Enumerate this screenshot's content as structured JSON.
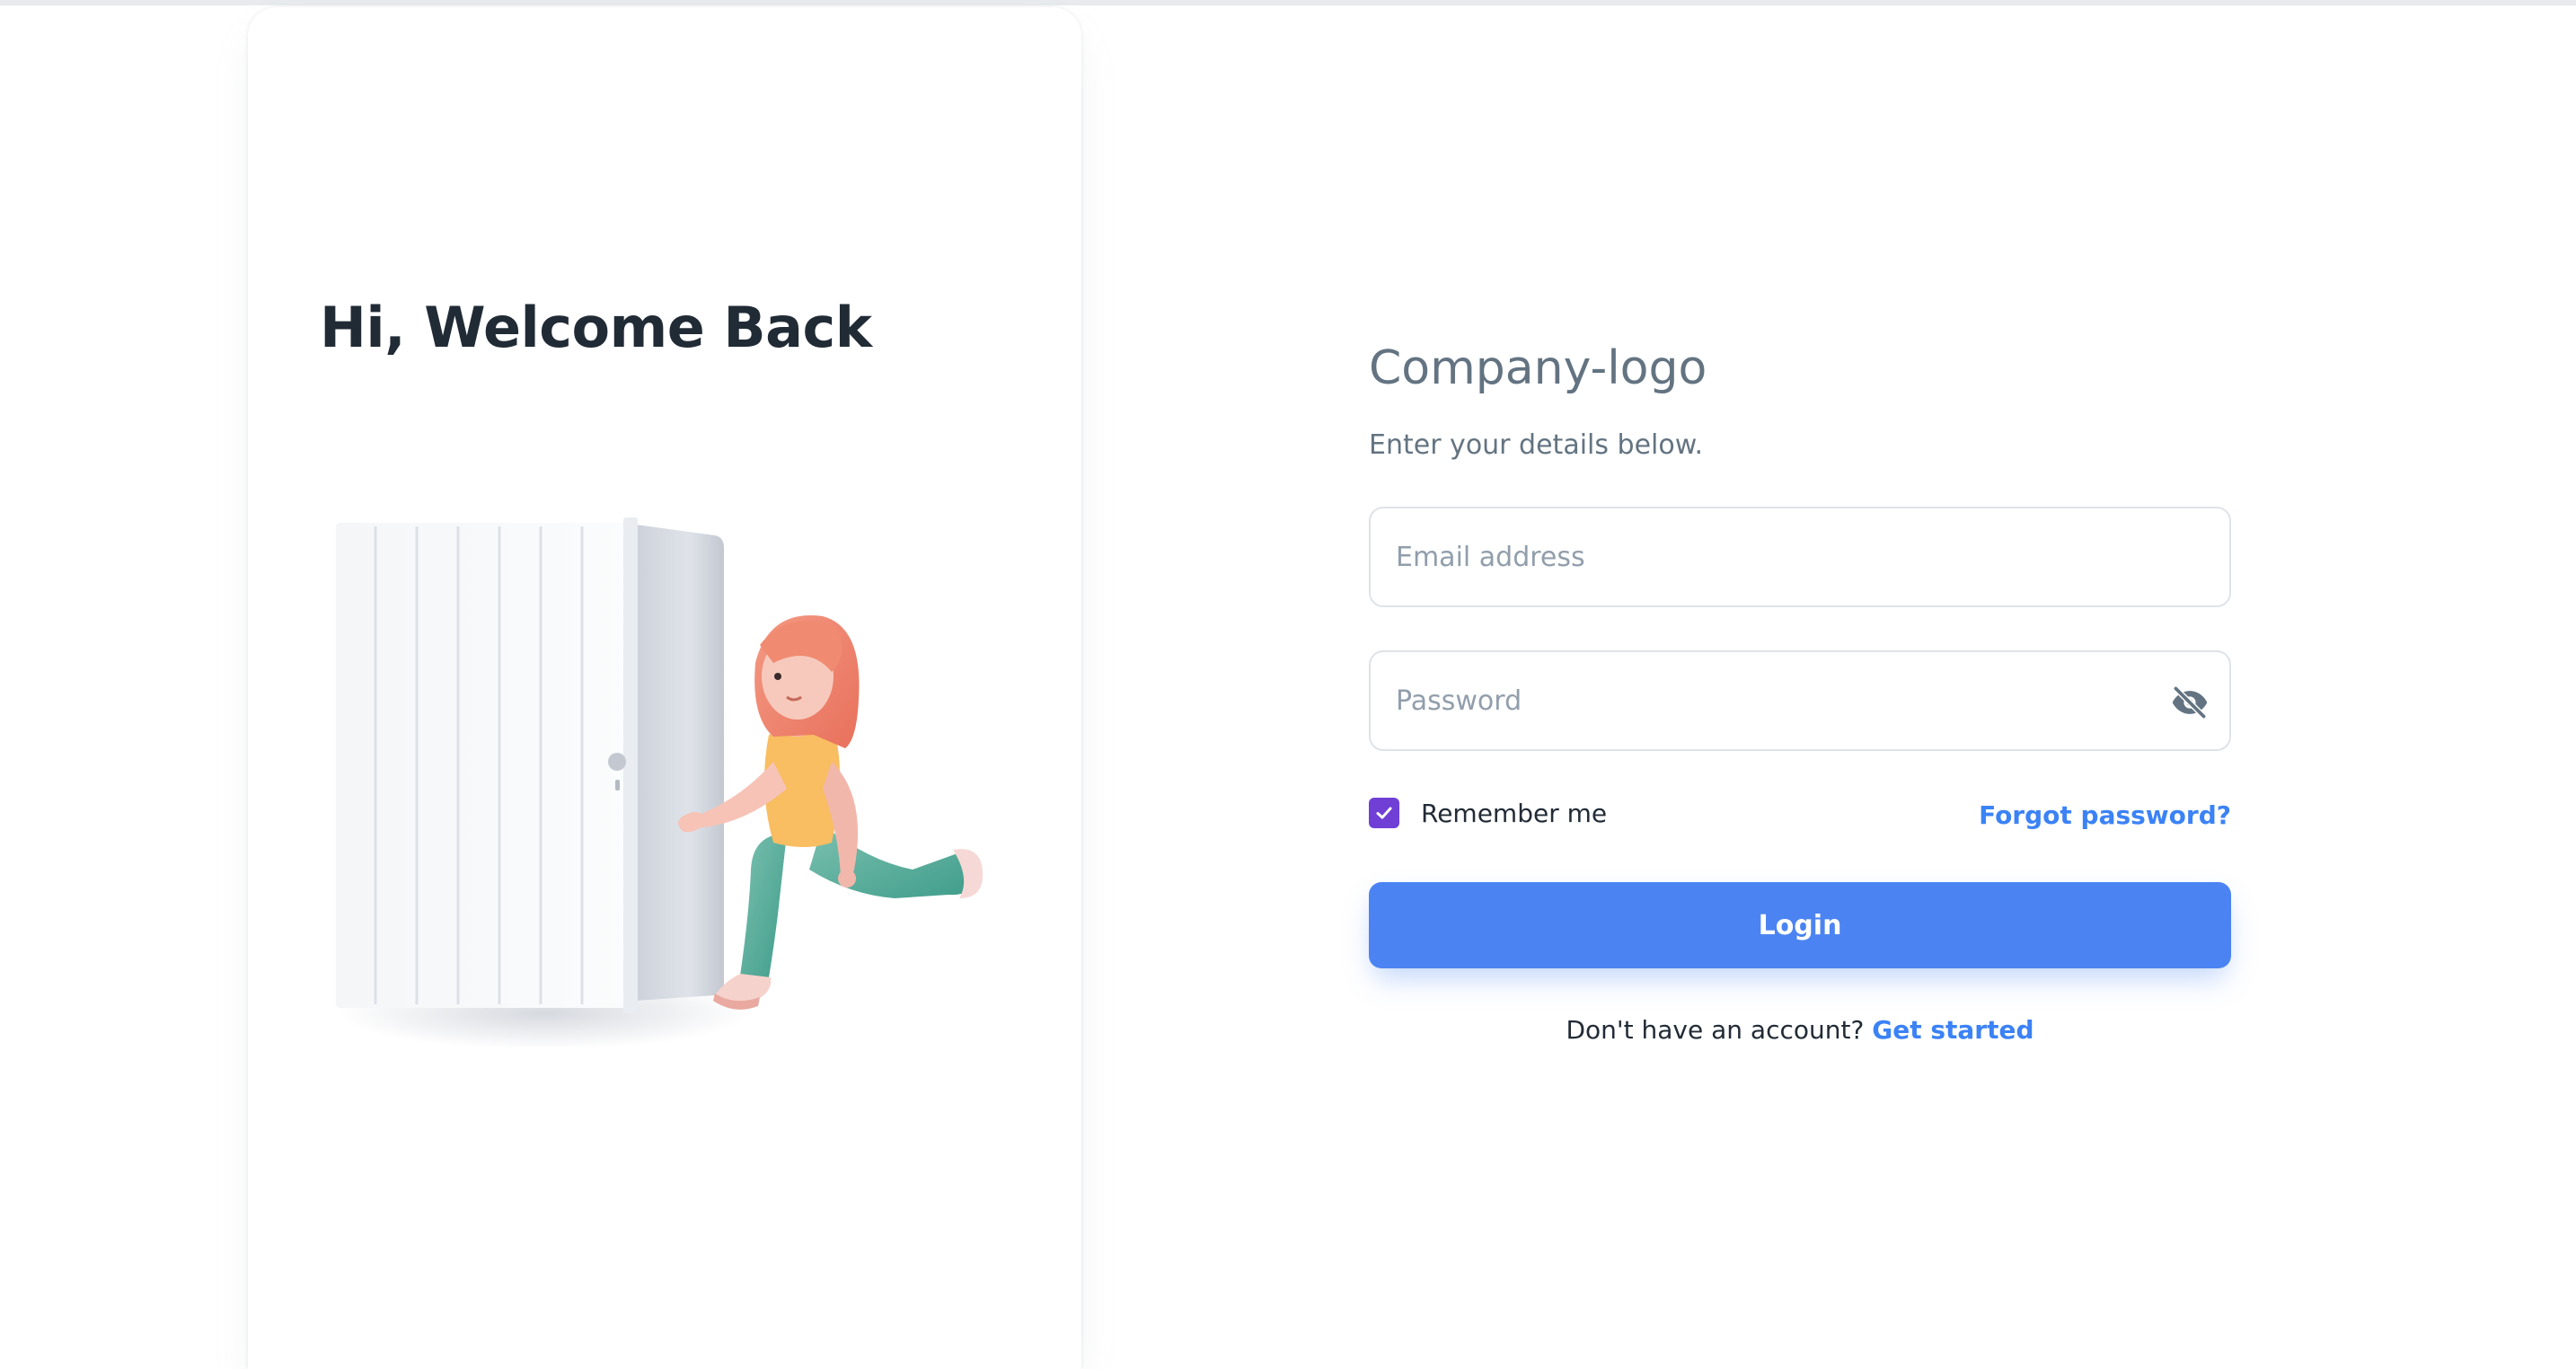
{
  "hero": {
    "title": "Hi, Welcome Back",
    "illustration": "person-running-through-door-illustration"
  },
  "brand": {
    "logo_text": "Company-logo"
  },
  "form": {
    "subtitle": "Enter your details below.",
    "email": {
      "placeholder": "Email address",
      "value": ""
    },
    "password": {
      "placeholder": "Password",
      "value": "",
      "visibility_icon": "eye-off-icon"
    },
    "remember_me": {
      "label": "Remember me",
      "checked": true
    },
    "forgot_password": "Forgot password?",
    "login_button": "Login",
    "signup_prompt": "Don't have an account?",
    "signup_link": "Get started"
  },
  "colors": {
    "primary": "#4b84f2",
    "link": "#3b82f6",
    "checkbox": "#6f3fd6",
    "heading": "#212b36",
    "muted": "#637381"
  }
}
